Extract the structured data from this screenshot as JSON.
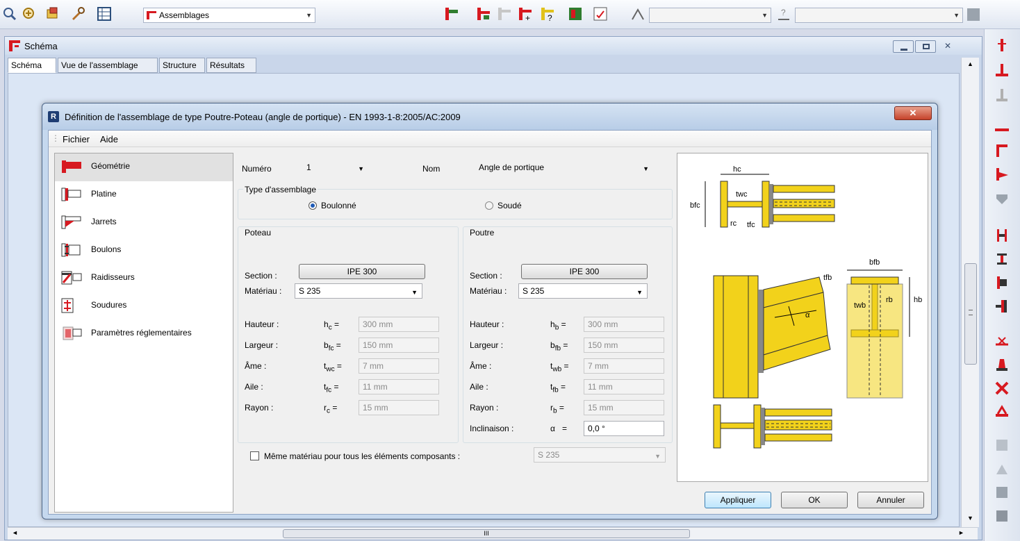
{
  "toolbar": {
    "module_combo": "Assemblages"
  },
  "mdi": {
    "title": "Schéma",
    "tabs": [
      "Schéma",
      "Vue de l'assemblage",
      "Structure",
      "Résultats"
    ],
    "hscroll_glyph": "III"
  },
  "dialog": {
    "title": "Définition de l'assemblage de type Poutre-Poteau (angle de portique) - EN 1993-1-8:2005/AC:2009",
    "title_badge": "R",
    "menu": [
      "Fichier",
      "Aide"
    ],
    "nav": [
      {
        "label": "Géométrie",
        "icon": "geometry-icon"
      },
      {
        "label": "Platine",
        "icon": "plate-icon"
      },
      {
        "label": "Jarrets",
        "icon": "haunch-icon"
      },
      {
        "label": "Boulons",
        "icon": "bolts-icon"
      },
      {
        "label": "Raidisseurs",
        "icon": "stiffeners-icon"
      },
      {
        "label": "Soudures",
        "icon": "welds-icon"
      },
      {
        "label": "Paramètres réglementaires",
        "icon": "code-params-icon"
      }
    ],
    "numero_label": "Numéro",
    "numero_value": "1",
    "nom_label": "Nom",
    "nom_value": "Angle de portique",
    "type_label": "Type d'assemblage",
    "radio_bolted": "Boulonné",
    "radio_welded": "Soudé",
    "poteau": {
      "title": "Poteau",
      "section_label": "Section :",
      "section_value": "IPE 300",
      "material_label": "Matériau :",
      "material_value": "S 235",
      "rows": [
        {
          "label": "Hauteur :",
          "sym": "h",
          "sub": "c",
          "value": "300 mm"
        },
        {
          "label": "Largeur :",
          "sym": "b",
          "sub": "fc",
          "value": "150 mm"
        },
        {
          "label": "Âme :",
          "sym": "t",
          "sub": "wc",
          "value": "7 mm"
        },
        {
          "label": "Aile :",
          "sym": "t",
          "sub": "fc",
          "value": "11 mm"
        },
        {
          "label": "Rayon :",
          "sym": "r",
          "sub": "c",
          "value": "15 mm"
        }
      ]
    },
    "poutre": {
      "title": "Poutre",
      "section_label": "Section :",
      "section_value": "IPE 300",
      "material_label": "Matériau :",
      "material_value": "S 235",
      "rows": [
        {
          "label": "Hauteur :",
          "sym": "h",
          "sub": "b",
          "value": "300 mm"
        },
        {
          "label": "Largeur :",
          "sym": "b",
          "sub": "fb",
          "value": "150 mm"
        },
        {
          "label": "Âme :",
          "sym": "t",
          "sub": "wb",
          "value": "7 mm"
        },
        {
          "label": "Aile :",
          "sym": "t",
          "sub": "fb",
          "value": "11 mm"
        },
        {
          "label": "Rayon :",
          "sym": "r",
          "sub": "b",
          "value": "15 mm"
        }
      ],
      "incl_label": "Inclinaison :",
      "incl_sym": "α",
      "incl_value": "0,0 °"
    },
    "same_material_label": "Même matériau pour tous les éléments composants :",
    "same_material_value": "S 235",
    "diagram_labels": {
      "hc": "hc",
      "bfc": "bfc",
      "twc": "twc",
      "tfc": "tfc",
      "rc": "rc",
      "bfb": "bfb",
      "tfb": "tfb",
      "twb": "twb",
      "rb": "rb",
      "hb": "hb",
      "alpha": "α"
    },
    "buttons": {
      "apply": "Appliquer",
      "ok": "OK",
      "cancel": "Annuler"
    }
  },
  "colors": {
    "steel_yellow": "#f2d21b",
    "brand_red": "#d71920"
  }
}
